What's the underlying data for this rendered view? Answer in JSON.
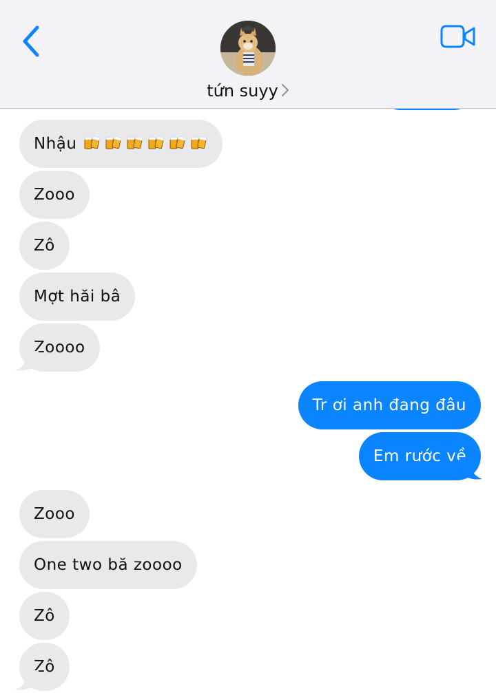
{
  "header": {
    "contact_name": "tứn suyy",
    "back_icon": "chevron-left-icon",
    "video_icon": "video-camera-icon",
    "accent_color": "#0a84ff"
  },
  "messages": [
    {
      "side": "received",
      "text": "Nhậu",
      "emoji": [
        "beer-mugs",
        "beer-mugs",
        "beer-mugs",
        "beer-mugs",
        "beer-mugs",
        "beer-mugs"
      ]
    },
    {
      "side": "received",
      "text": "Zooo"
    },
    {
      "side": "received",
      "text": "Zô"
    },
    {
      "side": "received",
      "text": "Mợt hăi bâ"
    },
    {
      "side": "received",
      "text": "Zoooo"
    },
    {
      "side": "sent",
      "text": "Tr ơi anh đang đâu"
    },
    {
      "side": "sent",
      "text": "Em rước về"
    },
    {
      "side": "received",
      "text": "Zooo"
    },
    {
      "side": "received",
      "text": "One two bă zoooo"
    },
    {
      "side": "received",
      "text": "Zô"
    },
    {
      "side": "received",
      "text": "Zô"
    }
  ]
}
